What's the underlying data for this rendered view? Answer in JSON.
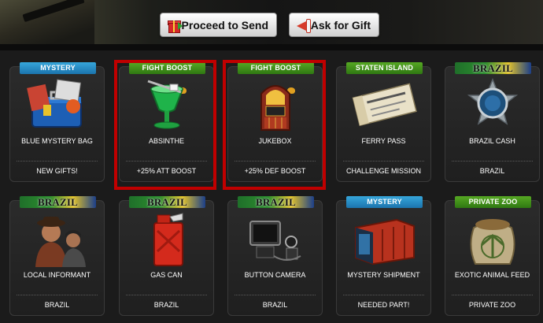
{
  "toolbar": {
    "send_label": "Proceed to Send",
    "gift_label": "Ask for Gift"
  },
  "items": [
    {
      "tag": "MYSTERY",
      "tag_style": "blue",
      "name": "BLUE MYSTERY BAG",
      "footer": "NEW GIFTS!",
      "icon": "blue-mystery-bag-icon"
    },
    {
      "tag": "FIGHT BOOST",
      "tag_style": "green",
      "name": "ABSINTHE",
      "footer": "+25% ATT BOOST",
      "icon": "absinthe-glass-icon",
      "selected": true
    },
    {
      "tag": "FIGHT BOOST",
      "tag_style": "green",
      "name": "JUKEBOX",
      "footer": "+25% DEF BOOST",
      "icon": "jukebox-icon",
      "selected": true
    },
    {
      "tag": "STATEN ISLAND",
      "tag_style": "green",
      "name": "FERRY PASS",
      "footer": "CHALLENGE MISSION",
      "icon": "ferry-pass-icon"
    },
    {
      "tag": "BRAZIL",
      "tag_style": "brazil",
      "name": "BRAZIL CASH",
      "footer": "BRAZIL",
      "icon": "brazil-cash-badge-icon"
    },
    {
      "tag": "BRAZIL",
      "tag_style": "brazil",
      "name": "LOCAL INFORMANT",
      "footer": "BRAZIL",
      "icon": "local-informant-icon"
    },
    {
      "tag": "BRAZIL",
      "tag_style": "brazil",
      "name": "GAS CAN",
      "footer": "BRAZIL",
      "icon": "gas-can-icon"
    },
    {
      "tag": "BRAZIL",
      "tag_style": "brazil",
      "name": "BUTTON CAMERA",
      "footer": "BRAZIL",
      "icon": "button-camera-icon"
    },
    {
      "tag": "MYSTERY",
      "tag_style": "blue",
      "name": "MYSTERY SHIPMENT",
      "footer": "NEEDED PART!",
      "icon": "shipping-container-icon"
    },
    {
      "tag": "PRIVATE ZOO",
      "tag_style": "green",
      "name": "EXOTIC ANIMAL FEED",
      "footer": "PRIVATE ZOO",
      "icon": "animal-feed-sack-icon"
    }
  ],
  "colors": {
    "highlight": "#c00000",
    "tag_blue": "#1b74ad",
    "tag_green": "#2f7812"
  }
}
